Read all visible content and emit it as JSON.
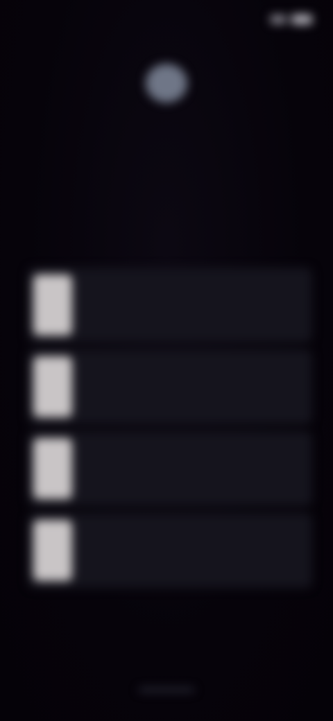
{
  "status_bar": {
    "time": "",
    "signal_icon": "signal-icon",
    "battery_icon": "battery-icon"
  },
  "header": {
    "app_icon": "app-avatar-icon",
    "title": "",
    "subtitle": ""
  },
  "list": {
    "items": [
      {
        "label": "",
        "thumb_icon": "item-thumbnail"
      },
      {
        "label": "",
        "thumb_icon": "item-thumbnail"
      },
      {
        "label": "",
        "thumb_icon": "item-thumbnail"
      },
      {
        "label": "",
        "thumb_icon": "item-thumbnail"
      }
    ]
  },
  "colors": {
    "background": "#07030b",
    "card": "#15141d",
    "thumbnail": "#c9c5c6",
    "avatar": "#6f7687"
  }
}
